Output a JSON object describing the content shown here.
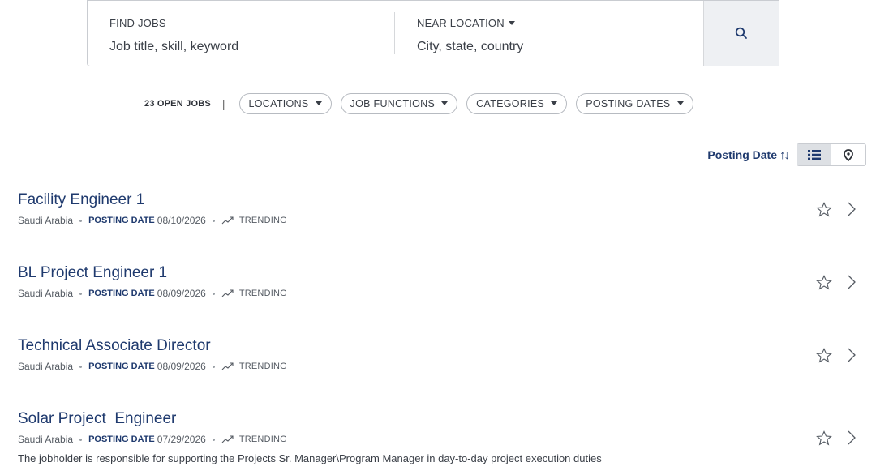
{
  "search": {
    "find_label": "FIND JOBS",
    "find_placeholder": "Job title, skill, keyword",
    "location_label": "NEAR LOCATION",
    "location_placeholder": "City, state, country",
    "search_icon": "search-icon"
  },
  "filters": {
    "open_jobs": "23 OPEN JOBS",
    "separator": "|",
    "pills": [
      "LOCATIONS",
      "JOB FUNCTIONS",
      "CATEGORIES",
      "POSTING DATES"
    ]
  },
  "sort": {
    "label": "Posting Date",
    "icon": "↑↓",
    "views": [
      "list-view-icon",
      "map-pin-icon"
    ],
    "active_view": "list"
  },
  "jobs": [
    {
      "title": "Facility Engineer 1",
      "location": "Saudi Arabia",
      "posting_label": "POSTING DATE",
      "date": "08/10/2026",
      "trend": "TRENDING",
      "description": ""
    },
    {
      "title": "BL Project Engineer 1",
      "location": "Saudi Arabia",
      "posting_label": "POSTING DATE",
      "date": "08/09/2026",
      "trend": "TRENDING",
      "description": ""
    },
    {
      "title": "Technical Associate Director",
      "location": "Saudi Arabia",
      "posting_label": "POSTING DATE",
      "date": "08/09/2026",
      "trend": "TRENDING",
      "description": ""
    },
    {
      "title": "Solar Project  Engineer",
      "location": "Saudi Arabia",
      "posting_label": "POSTING DATE",
      "date": "07/29/2026",
      "trend": "TRENDING",
      "description": "The jobholder is responsible for supporting the Projects Sr. Manager\\Program Manager in day-to-day project execution duties"
    }
  ],
  "colors": {
    "accent": "#1f3a6e",
    "border": "#c9ccd1",
    "button_bg": "#eef0f3"
  }
}
